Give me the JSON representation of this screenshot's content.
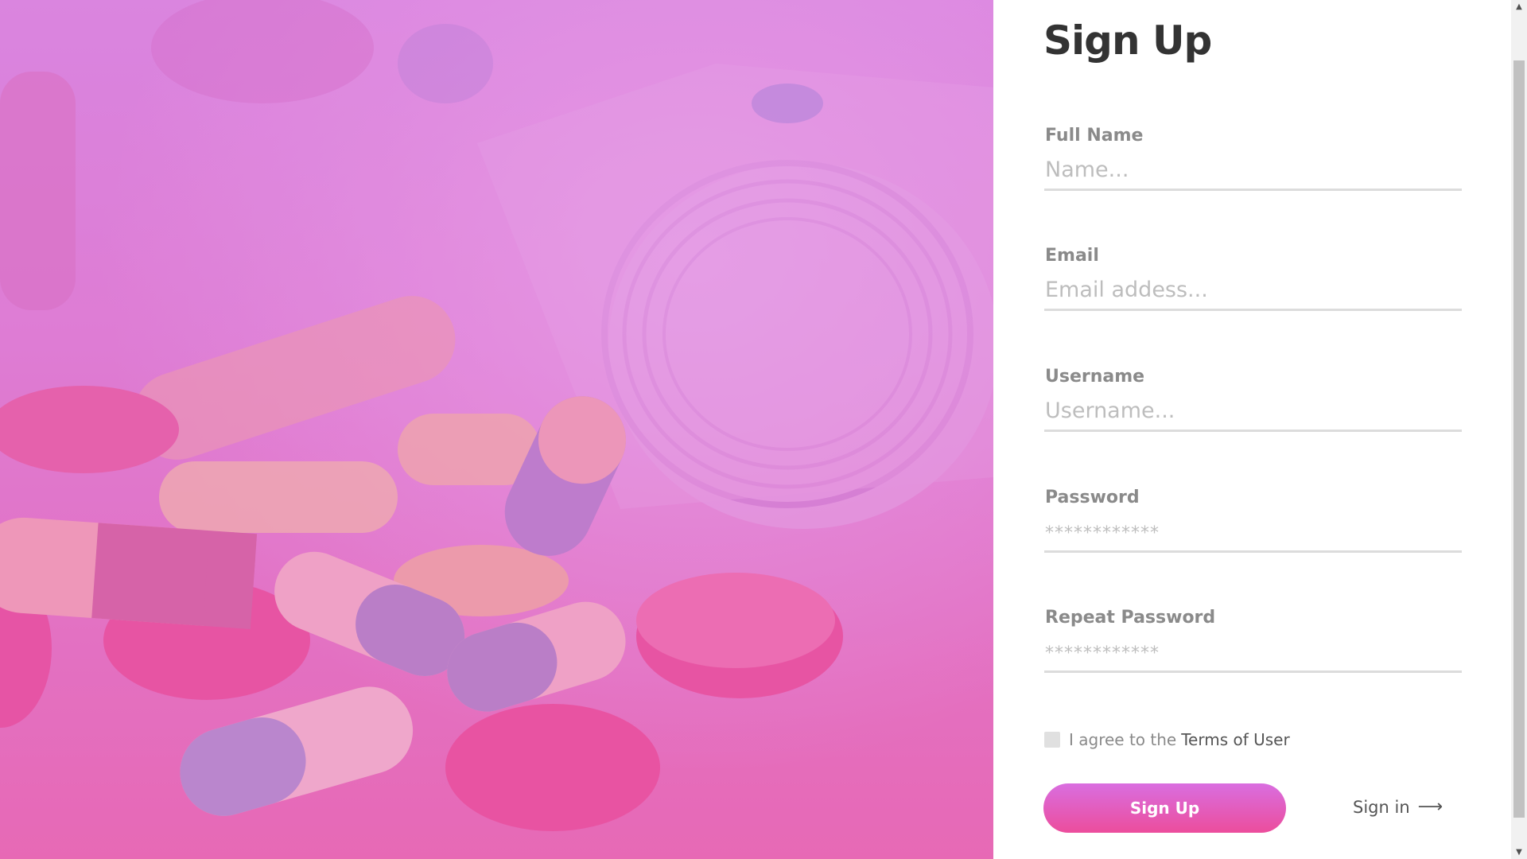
{
  "signup": {
    "title": "Sign Up",
    "fields": [
      {
        "label": "Full Name",
        "placeholder": "Name..."
      },
      {
        "label": "Email",
        "placeholder": "Email addess..."
      },
      {
        "label": "Username",
        "placeholder": "Username..."
      },
      {
        "label": "Password",
        "placeholder": "************"
      },
      {
        "label": "Repeat Password",
        "placeholder": "************"
      }
    ],
    "agree_prefix": "I agree to the",
    "terms_link": "Terms of User",
    "submit_label": "Sign Up",
    "signin_label": "Sign in",
    "signin_arrow": "⟶"
  },
  "scrollbar": {
    "up": "▲",
    "down": "▼"
  },
  "colors": {
    "accent_start": "#d96ee0",
    "accent_end": "#ec4d9c",
    "hero_overlay": "#e06fc4",
    "title": "#333333",
    "label": "#8a8a8a",
    "placeholder": "#bdbdbd"
  }
}
